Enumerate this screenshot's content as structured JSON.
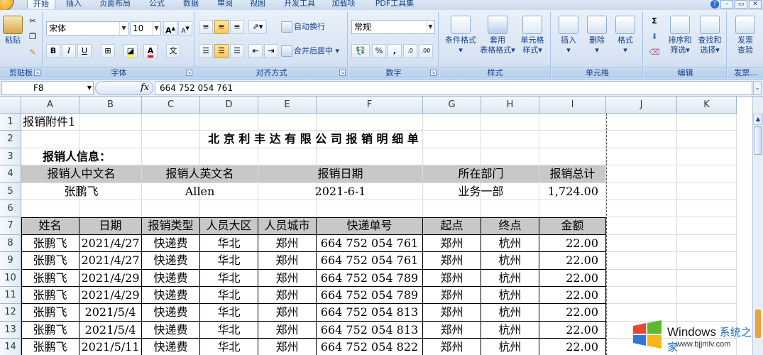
{
  "tabs": [
    {
      "label": "开始",
      "active": true
    },
    {
      "label": "插入"
    },
    {
      "label": "页面布局"
    },
    {
      "label": "公式"
    },
    {
      "label": "数据"
    },
    {
      "label": "审阅"
    },
    {
      "label": "视图"
    },
    {
      "label": "开发工具"
    },
    {
      "label": "加载项"
    },
    {
      "label": "PDF工具集"
    }
  ],
  "window_controls": {
    "help": "?",
    "minimize": "–",
    "restore": "▭",
    "close": "✕"
  },
  "ribbon": {
    "clipboard": {
      "label": "剪贴板",
      "paste": "粘贴"
    },
    "font": {
      "label": "字体",
      "name": "宋体",
      "size": "10",
      "grow": "A",
      "shrink": "A",
      "bold": "B",
      "italic": "I",
      "underline": "U",
      "wen": "文"
    },
    "alignment": {
      "label": "对齐方式",
      "wrap": "自动换行",
      "merge": "合并后居中"
    },
    "number": {
      "label": "数字",
      "format": "常规",
      "percent": "%",
      "comma": ",",
      "inc": ".0",
      "dec": ".00"
    },
    "styles": {
      "label": "样式",
      "conditional_1": "条件格式",
      "table_1": "套用",
      "table_2": "表格格式",
      "cell_1": "单元格",
      "cell_2": "样式"
    },
    "cells": {
      "label": "单元格",
      "insert": "插入",
      "delete": "删除",
      "format": "格式"
    },
    "editing": {
      "label": "编辑",
      "sum": "Σ",
      "sort_1": "排序和",
      "sort_2": "筛选",
      "find_1": "查找和",
      "find_2": "选择"
    },
    "invoice": {
      "label": "发票...",
      "check_1": "发票",
      "check_2": "查验"
    }
  },
  "formula_bar": {
    "name_box": "F8",
    "fx": "fx",
    "value": "664 752 054 761"
  },
  "columns": [
    "A",
    "B",
    "C",
    "D",
    "E",
    "F",
    "G",
    "H",
    "I",
    "J",
    "K"
  ],
  "rows": [
    "1",
    "2",
    "3",
    "4",
    "5",
    "6",
    "7",
    "8",
    "9",
    "10",
    "11",
    "12",
    "13",
    "14"
  ],
  "sheet": {
    "attachment": "报销附件1",
    "title": "北 京 利 丰 达 有 限 公 司 报 销 明 细 单",
    "info_label": "报销人信息：",
    "info_headers": [
      "报销人中文名",
      "报销人英文名",
      "报销日期",
      "所在部门",
      "报销总计"
    ],
    "info_values": [
      "张鹏飞",
      "Allen",
      "2021-6-1",
      "业务一部",
      "1,724.00"
    ],
    "table_headers": [
      "姓名",
      "日期",
      "报销类型",
      "人员大区",
      "人员城市",
      "快递单号",
      "起点",
      "终点",
      "金额"
    ],
    "table_rows": [
      [
        "张鹏飞",
        "2021/4/27",
        "快递费",
        "华北",
        "郑州",
        "664 752 054 761",
        "郑州",
        "杭州",
        "22.00"
      ],
      [
        "张鹏飞",
        "2021/4/27",
        "快递费",
        "华北",
        "郑州",
        "664 752 054 761",
        "郑州",
        "杭州",
        "22.00"
      ],
      [
        "张鹏飞",
        "2021/4/29",
        "快递费",
        "华北",
        "郑州",
        "664 752 054 789",
        "郑州",
        "杭州",
        "22.00"
      ],
      [
        "张鹏飞",
        "2021/4/29",
        "快递费",
        "华北",
        "郑州",
        "664 752 054 789",
        "郑州",
        "杭州",
        "22.00"
      ],
      [
        "张鹏飞",
        "2021/5/4",
        "快递费",
        "华北",
        "郑州",
        "664 752 054 813",
        "郑州",
        "杭州",
        "22.00"
      ],
      [
        "张鹏飞",
        "2021/5/4",
        "快递费",
        "华北",
        "郑州",
        "664 752 054 813",
        "郑州",
        "杭州",
        "22.00"
      ],
      [
        "张鹏飞",
        "2021/5/11",
        "快递费",
        "华北",
        "郑州",
        "664 752 054 822",
        "郑州",
        "杭州",
        "22.00"
      ]
    ]
  },
  "watermark": {
    "brand": "Windows",
    "brand_cn": "系统之家",
    "url": "www.bjjmlv.com"
  },
  "colors": {
    "ribbon": "#dae6f4",
    "header_shade": "#c8c8c8",
    "accent": "#15428b"
  }
}
